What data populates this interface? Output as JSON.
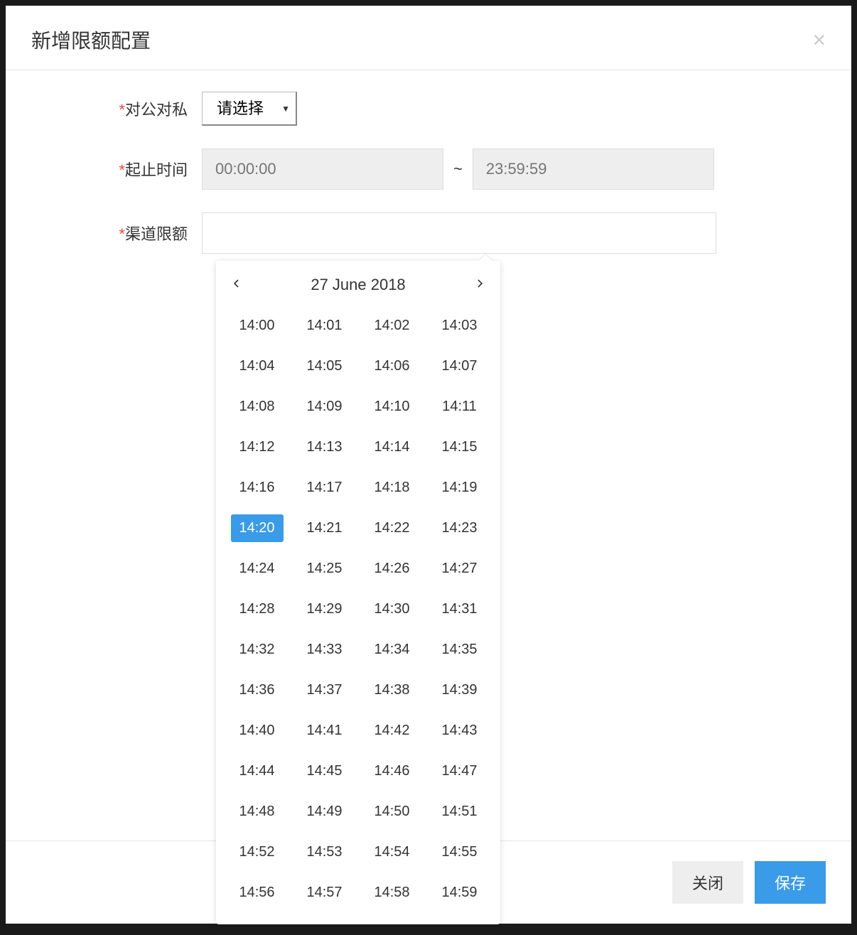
{
  "modal": {
    "title": "新增限额配置",
    "close_glyph": "×"
  },
  "form": {
    "public_private": {
      "label": "对公对私",
      "placeholder": "请选择"
    },
    "time_range": {
      "label": "起止时间",
      "start_placeholder": "00:00:00",
      "end_placeholder": "23:59:59",
      "separator": "~"
    },
    "channel_quota": {
      "label": "渠道限额"
    }
  },
  "time_picker": {
    "header_title": "27 June 2018",
    "selected": "14:20",
    "options": [
      "14:00",
      "14:01",
      "14:02",
      "14:03",
      "14:04",
      "14:05",
      "14:06",
      "14:07",
      "14:08",
      "14:09",
      "14:10",
      "14:11",
      "14:12",
      "14:13",
      "14:14",
      "14:15",
      "14:16",
      "14:17",
      "14:18",
      "14:19",
      "14:20",
      "14:21",
      "14:22",
      "14:23",
      "14:24",
      "14:25",
      "14:26",
      "14:27",
      "14:28",
      "14:29",
      "14:30",
      "14:31",
      "14:32",
      "14:33",
      "14:34",
      "14:35",
      "14:36",
      "14:37",
      "14:38",
      "14:39",
      "14:40",
      "14:41",
      "14:42",
      "14:43",
      "14:44",
      "14:45",
      "14:46",
      "14:47",
      "14:48",
      "14:49",
      "14:50",
      "14:51",
      "14:52",
      "14:53",
      "14:54",
      "14:55",
      "14:56",
      "14:57",
      "14:58",
      "14:59"
    ]
  },
  "footer": {
    "close_label": "关闭",
    "save_label": "保存"
  },
  "colors": {
    "primary": "#3a9be8",
    "required": "#e74c3c"
  }
}
